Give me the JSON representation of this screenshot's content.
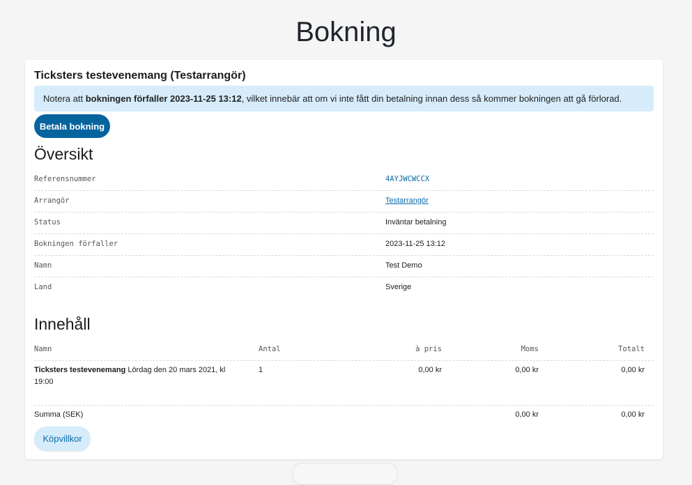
{
  "page": {
    "title": "Bokning"
  },
  "event": {
    "heading": "Ticksters testevenemang (Testarrangör)"
  },
  "notice": {
    "prefix": "Notera att ",
    "bold": "bokningen förfaller 2023-11-25 13:12",
    "suffix": ", vilket innebär att om vi inte fått din betalning innan dess så kommer bokningen att gå förlorad."
  },
  "buttons": {
    "pay": "Betala bokning",
    "terms": "Köpvillkor"
  },
  "overview": {
    "title": "Översikt",
    "rows": [
      {
        "label": "Referensnummer",
        "value": "4AYJWCWCCX"
      },
      {
        "label": "Arrangör",
        "value": "Testarrangör"
      },
      {
        "label": "Status",
        "value": "Inväntar betalning"
      },
      {
        "label": "Bokningen förfaller",
        "value": "2023-11-25 13:12"
      },
      {
        "label": "Namn",
        "value": "Test Demo"
      },
      {
        "label": "Land",
        "value": "Sverige"
      }
    ]
  },
  "contents": {
    "title": "Innehåll",
    "headers": {
      "name": "Namn",
      "qty": "Antal",
      "price": "à pris",
      "vat": "Moms",
      "total": "Totalt"
    },
    "items": [
      {
        "name_bold": "Ticksters testevenemang",
        "name_rest": " Lördag den 20 mars 2021, kl 19:00",
        "qty": "1",
        "price": "0,00 kr",
        "vat": "0,00 kr",
        "total": "0,00 kr"
      }
    ],
    "summary": {
      "label": "Summa (SEK)",
      "vat": "0,00 kr",
      "total": "0,00 kr"
    }
  }
}
